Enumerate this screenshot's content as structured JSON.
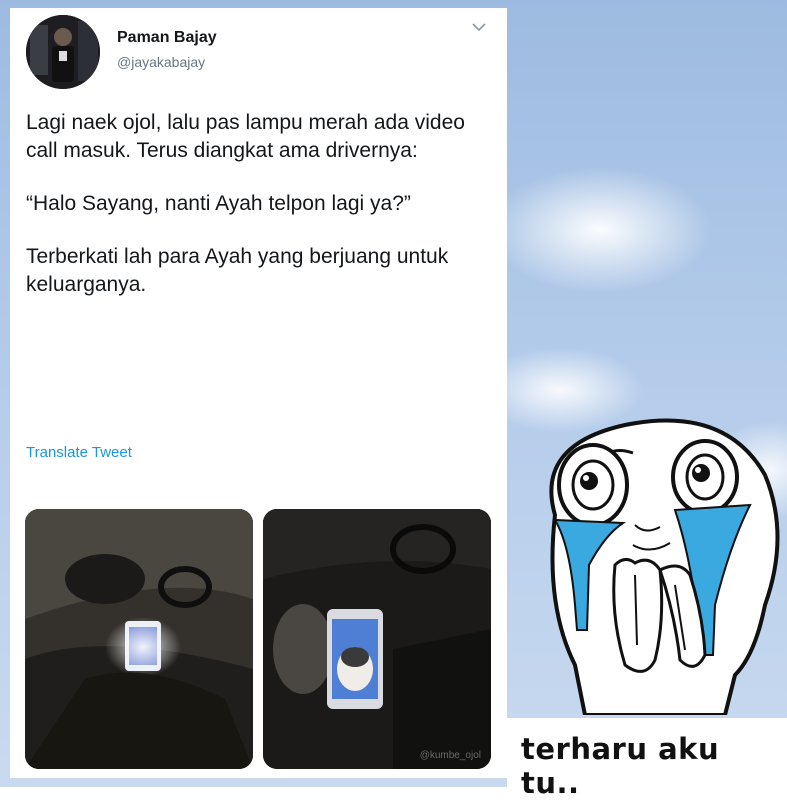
{
  "tweet": {
    "author_name": "Paman Bajay",
    "author_handle": "@jayakabajay",
    "paragraphs": [
      "Lagi naek ojol, lalu pas lampu merah ada video call masuk. Terus diangkat ama drivernya:",
      "“Halo Sayang, nanti Ayah telpon lagi ya?”",
      "Terberkati lah para Ayah yang berjuang untuk keluarganya."
    ],
    "translate_label": "Translate Tweet",
    "photo_watermark": "@kumbe_ojol"
  },
  "meme": {
    "caption": "terharu aku tu.."
  },
  "colors": {
    "link": "#1b95e0",
    "tears": "#3aa9e0",
    "sky": "#a9c4e7"
  }
}
